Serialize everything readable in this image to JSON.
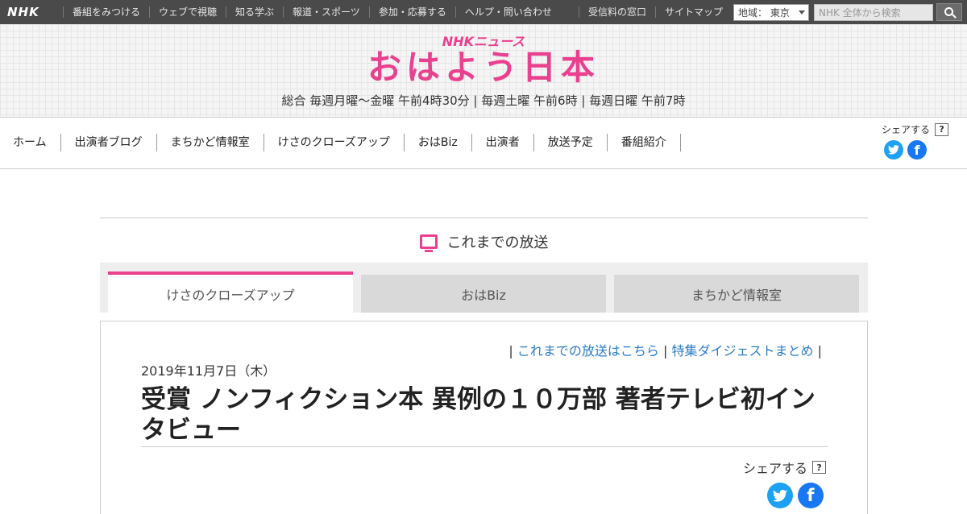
{
  "global_bar": {
    "logo": "NHK",
    "nav": [
      "番組をみつける",
      "ウェブで視聴",
      "知る学ぶ",
      "報道・スポーツ",
      "参加・応募する",
      "ヘルプ・問い合わせ"
    ],
    "right_links": [
      "受信料の窓口",
      "サイトマップ"
    ],
    "region_label": "地域： 東京",
    "search_placeholder": "NHK 全体から検索"
  },
  "header": {
    "brand": "NHKニュース",
    "title": "おはよう日本",
    "schedule": "総合 毎週月曜～金曜 午前4時30分 | 毎週土曜 午前6時 | 毎週日曜 午前7時"
  },
  "nav": {
    "items": [
      "ホーム",
      "出演者ブログ",
      "まちかど情報室",
      "けさのクローズアップ",
      "おはBiz",
      "出演者",
      "放送予定",
      "番組紹介"
    ],
    "share_label": "シェアする",
    "help": "?"
  },
  "section": {
    "heading": "これまでの放送",
    "icon": "tv-icon"
  },
  "tabs": [
    {
      "label": "けさのクローズアップ",
      "active": true
    },
    {
      "label": "おはBiz",
      "active": false
    },
    {
      "label": "まちかど情報室",
      "active": false
    }
  ],
  "article": {
    "links": [
      "これまでの放送はこちら",
      "特集ダイジェストまとめ"
    ],
    "date": "2019年11月7日（木）",
    "headline": "受賞 ノンフィクション本 異例の１０万部 著者テレビ初インタビュー",
    "share_label": "シェアする",
    "help": "?"
  },
  "colors": {
    "accent": "#e9408f",
    "link": "#2a7cc7",
    "twitter": "#1da1f2",
    "facebook": "#1877f2",
    "global_bar": "#4a4a4a"
  }
}
